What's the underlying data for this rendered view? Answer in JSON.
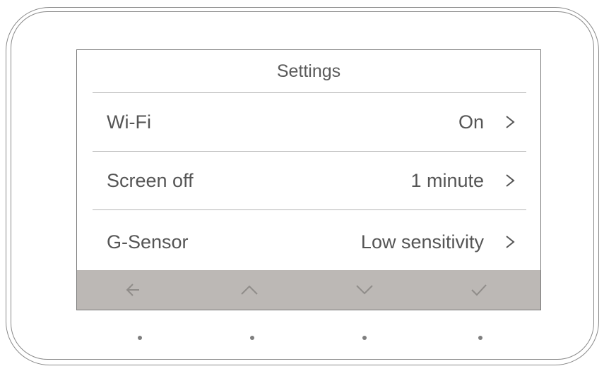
{
  "screen": {
    "title": "Settings",
    "items": [
      {
        "label": "Wi-Fi",
        "value": "On",
        "icon": "chevron-right-icon"
      },
      {
        "label": "Screen off",
        "value": "1 minute",
        "icon": "chevron-right-icon"
      },
      {
        "label": "G-Sensor",
        "value": "Low sensitivity",
        "icon": "chevron-right-icon"
      }
    ]
  },
  "button_bar": {
    "buttons": [
      {
        "icon": "back-arrow-icon"
      },
      {
        "icon": "chevron-up-icon"
      },
      {
        "icon": "chevron-down-icon"
      },
      {
        "icon": "checkmark-icon"
      }
    ],
    "background": "#bcb8b5",
    "icon_color": "#8f8c89"
  },
  "physical_buttons": {
    "count": 4,
    "icon": "dot-indicator-icon"
  },
  "colors": {
    "text": "#555555",
    "frame": "#8a8a8a",
    "divider": "#b5b5b5"
  }
}
